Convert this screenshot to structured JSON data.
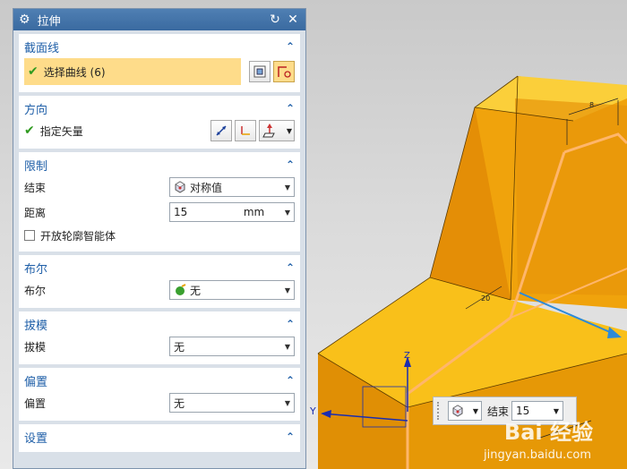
{
  "dialog": {
    "title": "拉伸",
    "icons": {
      "settings": "gear-icon",
      "reset": "reset-icon",
      "close": "close-icon"
    }
  },
  "sections": {
    "section_curve": {
      "title": "截面线",
      "select_label": "选择曲线 (6)"
    },
    "direction": {
      "title": "方向",
      "vector_label": "指定矢量"
    },
    "limits": {
      "title": "限制",
      "end_label": "结束",
      "end_value": "对称值",
      "distance_label": "距离",
      "distance_value": "15",
      "distance_unit": "mm",
      "open_profile_label": "开放轮廓智能体"
    },
    "boolean": {
      "title": "布尔",
      "label": "布尔",
      "value": "无"
    },
    "draft": {
      "title": "拔模",
      "label": "拔模",
      "value": "无"
    },
    "offset": {
      "title": "偏置",
      "label": "偏置",
      "value": "无"
    },
    "settings": {
      "title": "设置"
    }
  },
  "float_toolbar": {
    "end_label": "结束",
    "end_value": "15"
  },
  "viewport_labels": {
    "axis_y": "Y",
    "axis_z": "Z"
  },
  "watermark": {
    "brand": "Bai 经验",
    "url": "jingyan.baidu.com"
  },
  "colors": {
    "accent": "#1f5fa8",
    "highlight": "#fedc8a",
    "solid": "#f4a711",
    "titlebar": "#3a6aa0"
  }
}
